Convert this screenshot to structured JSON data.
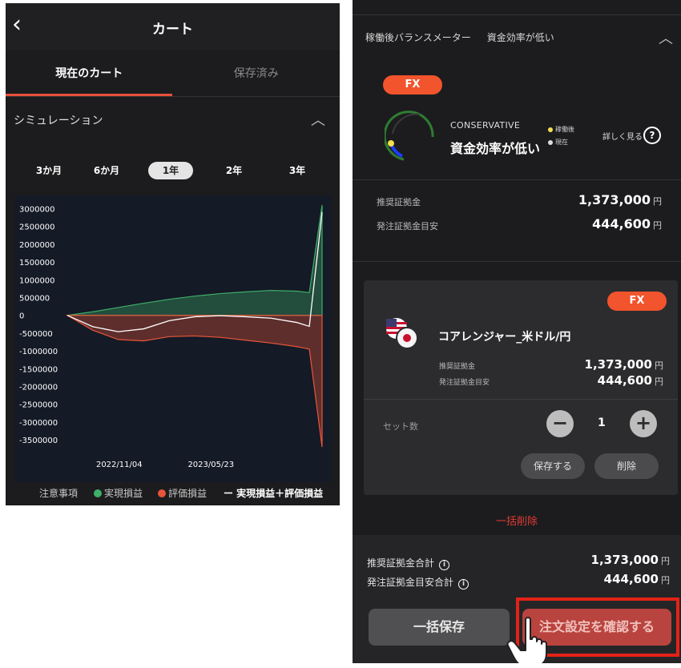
{
  "left": {
    "back_glyph": "‹",
    "title": "カート",
    "tabs": [
      "現在のカート",
      "保存済み"
    ],
    "section_label": "シミュレーション",
    "periods": [
      "3か月",
      "6か月",
      "1年",
      "2年",
      "3年"
    ],
    "selected_period": "1年",
    "legend": {
      "caution": "注意事項",
      "realized": "実現損益",
      "unrealized": "評価損益",
      "total": "ー 実現損益＋評価損益"
    }
  },
  "chart_data": {
    "type": "area",
    "x_ticks": [
      "2022/11/04",
      "2023/05/23"
    ],
    "y_ticks": [
      3000000,
      2500000,
      2000000,
      1500000,
      1000000,
      500000,
      0,
      -500000,
      -1000000,
      -1500000,
      -2000000,
      -2500000,
      -3000000,
      -3500000
    ],
    "ylim": [
      -3700000,
      3100000
    ],
    "x": [
      0,
      10,
      20,
      30,
      40,
      50,
      60,
      70,
      80,
      90,
      95,
      100
    ],
    "series": [
      {
        "name": "実現損益",
        "color": "#3fae6a",
        "values": [
          0,
          100000,
          220000,
          340000,
          450000,
          540000,
          610000,
          660000,
          700000,
          680000,
          640000,
          3100000
        ]
      },
      {
        "name": "評価損益",
        "color": "#e8553a",
        "values": [
          0,
          -420000,
          -680000,
          -720000,
          -600000,
          -580000,
          -620000,
          -700000,
          -780000,
          -880000,
          -950000,
          -3700000
        ]
      },
      {
        "name": "実現損益＋評価損益",
        "color": "#ffffff",
        "values": [
          0,
          -320000,
          -460000,
          -380000,
          -150000,
          -40000,
          -10000,
          -40000,
          -80000,
          -200000,
          -310000,
          2900000
        ]
      }
    ],
    "colors": {
      "realized": "#3fae6a",
      "unrealized": "#e8553a",
      "total": "#ffffff",
      "background": "#141a26"
    }
  },
  "right": {
    "meter_title": "稼働後バランスメーター",
    "meter_status": "資金効率が低い",
    "fx_badge": "FX",
    "conservative": "CONSERVATIVE",
    "efficiency": "資金効率が低い",
    "legend_after": "稼働後",
    "legend_now": "現在",
    "details_link": "詳しく見る",
    "help_glyph": "?",
    "recommended_margin_label": "推奨証拠金",
    "recommended_margin_value": "1,373,000",
    "order_margin_label": "発注証拠金目安",
    "order_margin_value": "444,600",
    "yen": "円",
    "card": {
      "badge": "FX",
      "product_name": "コアレンジャー_米ドル/円",
      "rec_label": "推奨証拠金",
      "rec_value": "1,373,000",
      "order_label": "発注証拠金目安",
      "order_value": "444,600",
      "set_label": "セット数",
      "minus": "−",
      "qty": "1",
      "plus": "+",
      "save_label": "保存する",
      "delete_label": "削除"
    },
    "bulk_delete": "一括削除",
    "total_rec_label": "推奨証拠金合計",
    "total_rec_value": "1,373,000",
    "total_order_label": "発注証拠金目安合計",
    "total_order_value": "444,600",
    "info_glyph": "i",
    "save_all_label": "一括保存",
    "confirm_label": "注文設定を確認する",
    "colors": {
      "accent": "#f2542d",
      "danger": "#e03a35",
      "highlight": "#e32217"
    }
  }
}
